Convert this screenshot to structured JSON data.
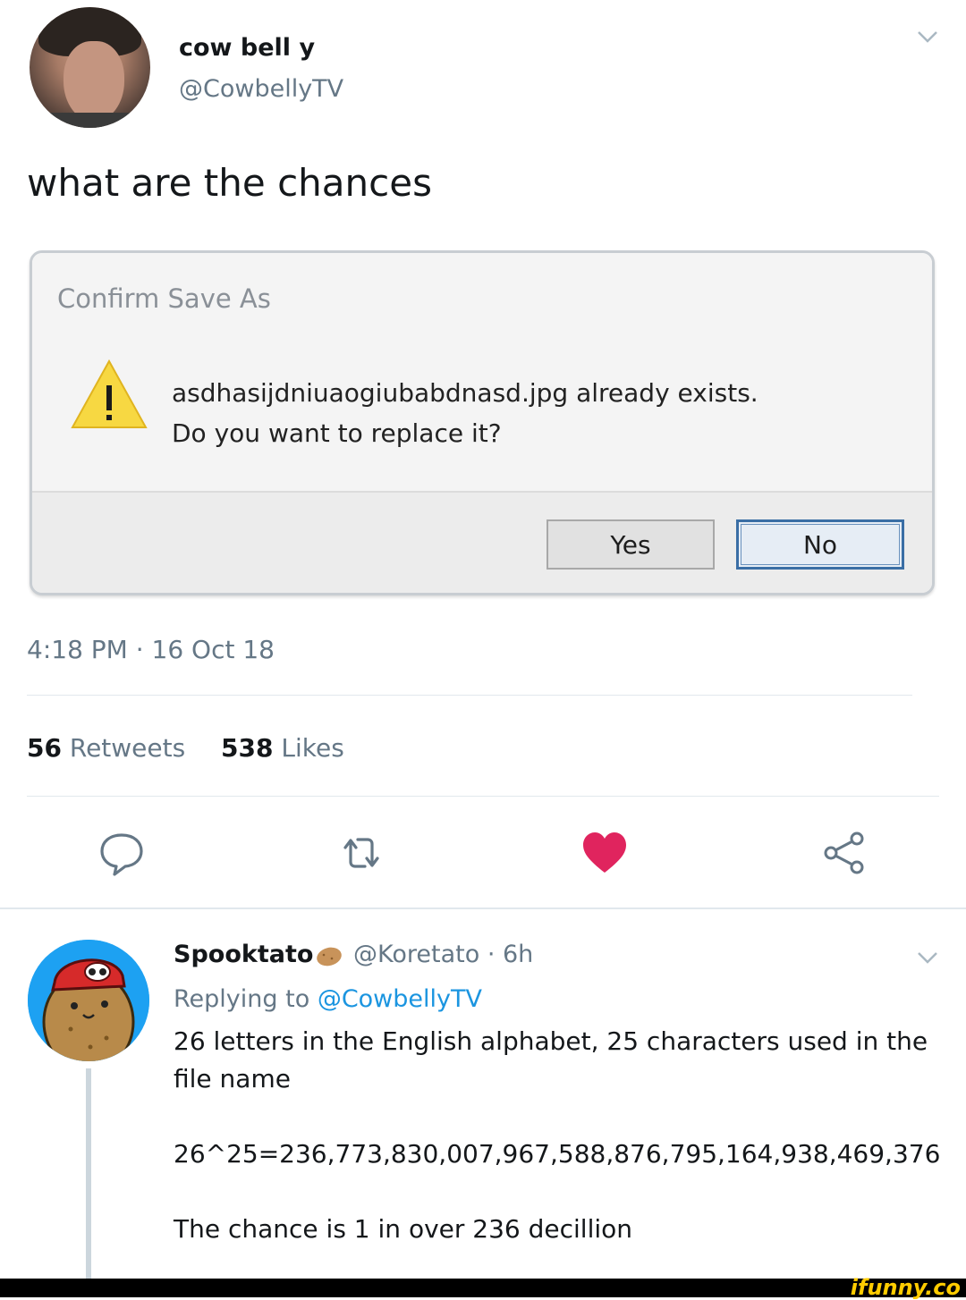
{
  "tweet": {
    "author_name": "cow bell y",
    "author_handle": "@CowbellyTV",
    "text": "what are the chances",
    "timestamp": "4:18 PM · 16 Oct 18",
    "retweets_count": "56",
    "retweets_label": "Retweets",
    "likes_count": "538",
    "likes_label": "Likes",
    "liked": true,
    "like_color": "#e0245e"
  },
  "dialog": {
    "title": "Confirm Save As",
    "message_line1": "asdhasijdniuaogiubabdnasd.jpg already exists.",
    "message_line2": "Do you want to replace it?",
    "yes_label": "Yes",
    "no_label": "No"
  },
  "reply": {
    "author_name": "Spooktato",
    "author_handle": "@Koretato",
    "time": "· 6h",
    "replying_prefix": "Replying to",
    "replying_to": "@CowbellyTV",
    "line1": "26 letters in the English alphabet, 25 characters used in the",
    "line2": "file name",
    "line3": "26^25=236,773,830,007,967,588,876,795,164,938,469,376",
    "line4": "The chance is 1 in over 236 decillion"
  },
  "watermark": "ifunny.co",
  "icons": [
    "chevron-down-icon",
    "warning-icon",
    "reply-icon",
    "retweet-icon",
    "heart-icon",
    "share-icon",
    "potato-emoji"
  ]
}
